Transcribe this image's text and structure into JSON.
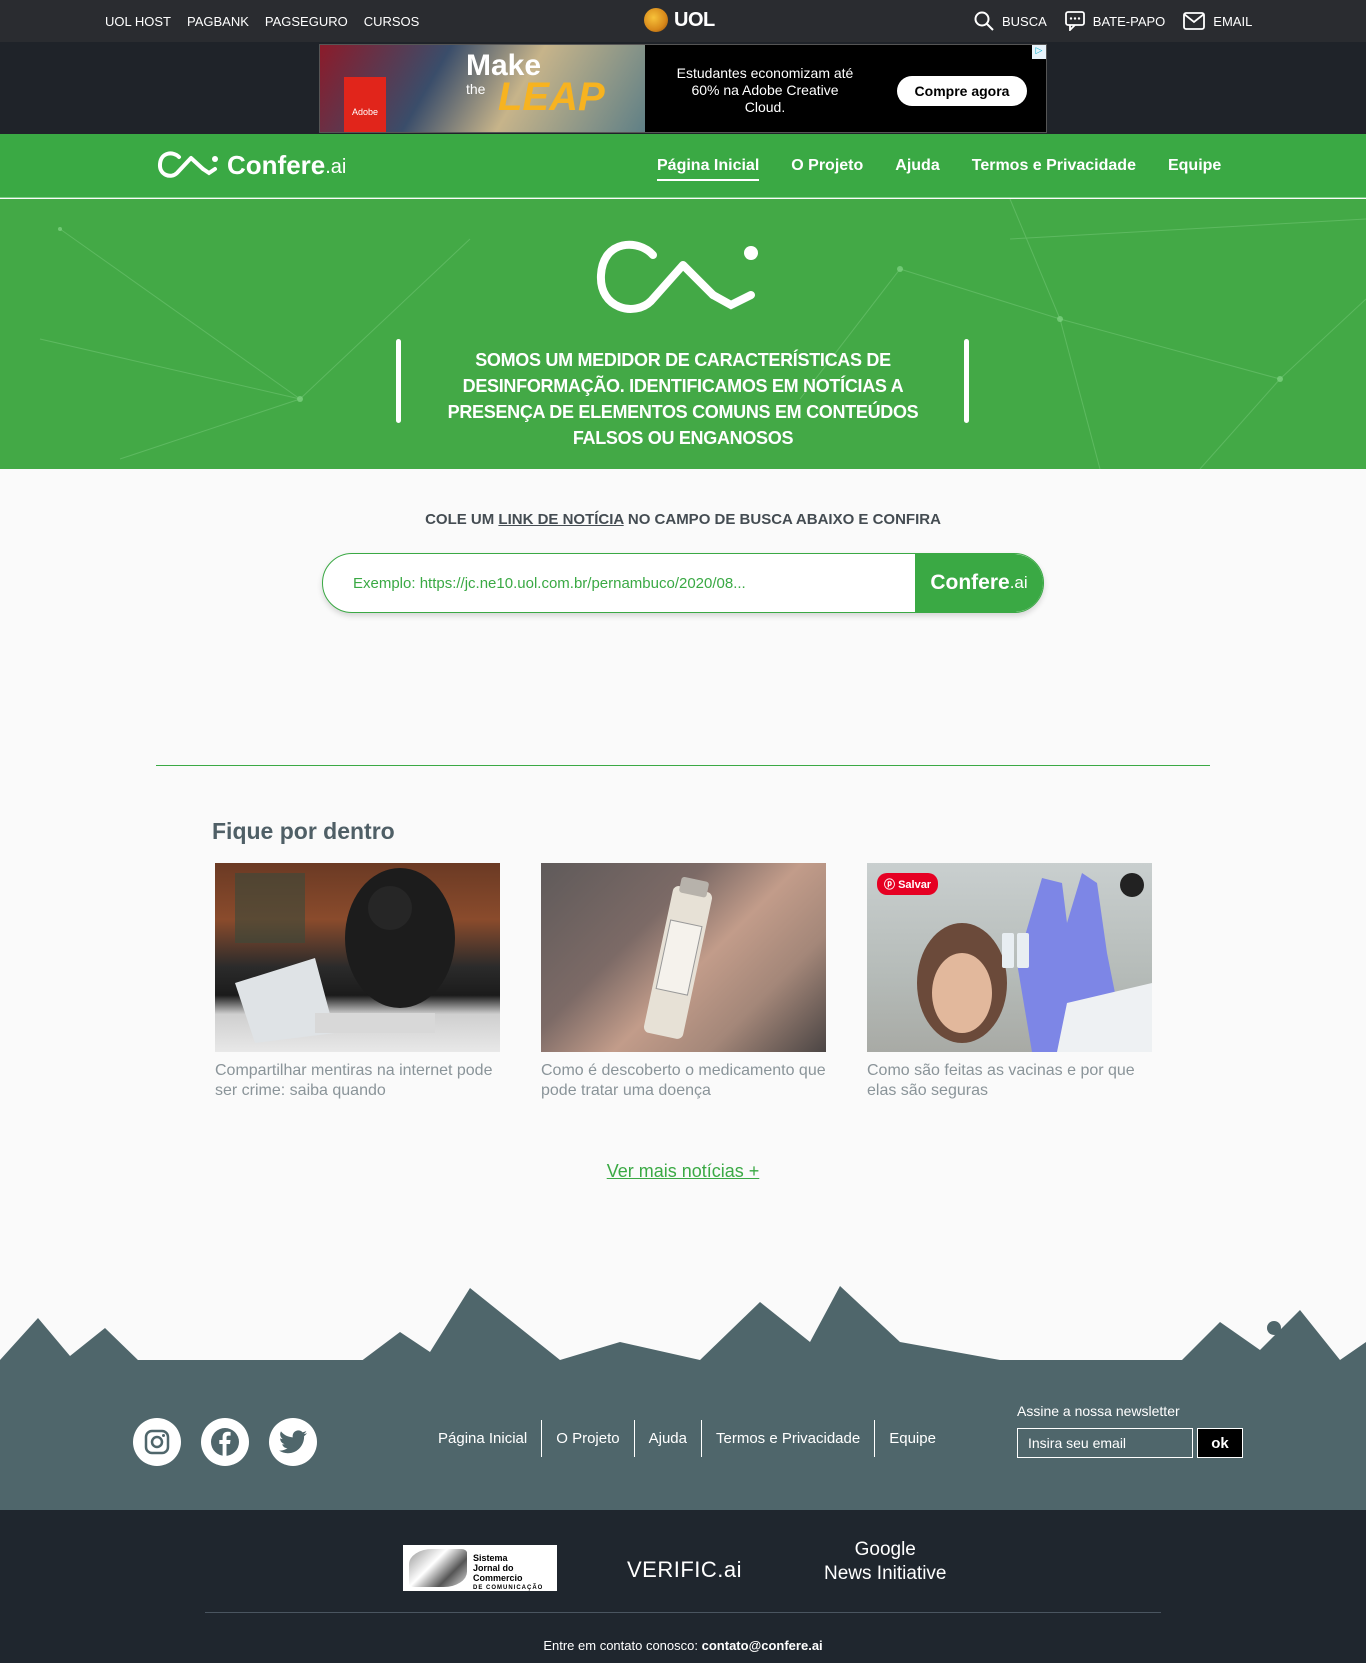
{
  "uol_bar": {
    "left_links": [
      "UOL HOST",
      "PAGBANK",
      "PAGSEGURO",
      "CURSOS"
    ],
    "logo_text": "UOL",
    "search_label": "BUSCA",
    "chat_label": "BATE-PAPO",
    "email_label": "EMAIL"
  },
  "ad": {
    "brand": "Adobe",
    "headline_make": "Make",
    "headline_the": "the",
    "headline_leap": "LEAP",
    "copy": "Estudantes economizam até 60% na Adobe Creative Cloud.",
    "cta": "Compre agora"
  },
  "nav": {
    "brand_word": "Confere",
    "brand_suffix": ".ai",
    "links": [
      "Página Inicial",
      "O Projeto",
      "Ajuda",
      "Termos e Privacidade",
      "Equipe"
    ],
    "active_index": 0
  },
  "hero": {
    "tagline": "SOMOS UM MEDIDOR DE CARACTERÍSTICAS DE DESINFORMAÇÃO. IDENTIFICAMOS EM NOTÍCIAS A PRESENÇA DE ELEMENTOS COMUNS EM CONTEÚDOS FALSOS OU ENGANOSOS"
  },
  "search": {
    "prompt_before": "COLE UM",
    "prompt_link": "LINK DE NOTÍCIA",
    "prompt_after": "NO CAMPO DE BUSCA ABAIXO E CONFIRA",
    "placeholder": "Exemplo: https://jc.ne10.uol.com.br/pernambuco/2020/08...",
    "button_word": "Confere",
    "button_suffix": ".ai"
  },
  "news": {
    "title": "Fique por dentro",
    "items": [
      {
        "caption": "Compartilhar mentiras na internet pode ser crime: saiba quando"
      },
      {
        "caption": "Como é descoberto o medicamento que pode tratar uma doença"
      },
      {
        "caption": "Como são feitas as vacinas e por que elas são seguras",
        "pin_label": "Salvar"
      }
    ],
    "more_link": "Ver mais notícias +"
  },
  "footer": {
    "links": [
      "Página Inicial",
      "O Projeto",
      "Ajuda",
      "Termos e Privacidade",
      "Equipe"
    ],
    "newsletter_label": "Assine a nossa newsletter",
    "newsletter_placeholder": "Insira seu email",
    "newsletter_button": "ok",
    "partners": {
      "jc_line1": "Sistema",
      "jc_line2": "Jornal do Commercio",
      "jc_line3": "DE COMUNICAÇÃO",
      "verific": "VERIFIC.ai",
      "gni_line1": "Google",
      "gni_line2": "News Initiative"
    },
    "contact_label": "Entre em contato conosco:",
    "contact_email": "contato@confere.ai"
  },
  "colors": {
    "green": "#3aa944",
    "dark_bar": "#2a2c30",
    "footer_slate": "#4f666b",
    "footer_dark": "#1f262e"
  }
}
